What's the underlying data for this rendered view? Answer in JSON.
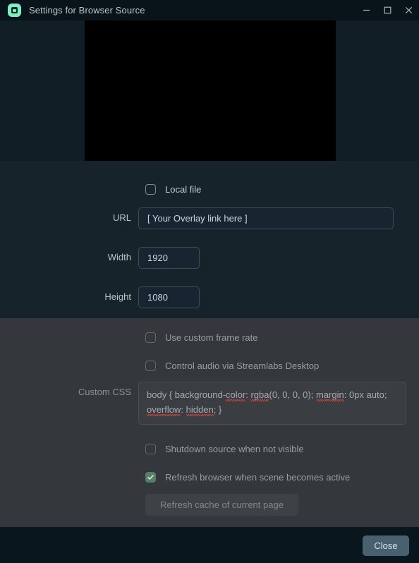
{
  "window": {
    "title": "Settings for Browser Source",
    "app_icon": "streamlabs-icon",
    "controls": {
      "minimize": "minimize-icon",
      "maximize": "maximize-icon",
      "close": "close-icon"
    }
  },
  "preview": {
    "name": "browser-source-preview",
    "background_color": "#000000"
  },
  "form": {
    "local_file": {
      "label": "Local file",
      "checked": false
    },
    "url": {
      "label": "URL",
      "value": "[ Your Overlay link here ]"
    },
    "width": {
      "label": "Width",
      "value": "1920"
    },
    "height": {
      "label": "Height",
      "value": "1080"
    },
    "use_custom_frame_rate": {
      "label": "Use custom frame rate",
      "checked": false
    },
    "control_audio": {
      "label": "Control audio via Streamlabs Desktop",
      "checked": false
    },
    "custom_css": {
      "label": "Custom CSS",
      "value": "body { background-color: rgba(0, 0, 0, 0); margin: 0px auto; overflow: hidden; }",
      "tokens": [
        {
          "text": "body { background-",
          "spellerror": false
        },
        {
          "text": "color",
          "spellerror": true
        },
        {
          "text": ": ",
          "spellerror": false
        },
        {
          "text": "rgba",
          "spellerror": true
        },
        {
          "text": "(0, 0, 0, 0); ",
          "spellerror": false
        },
        {
          "text": "margin",
          "spellerror": true
        },
        {
          "text": ": 0px auto; ",
          "spellerror": false
        },
        {
          "text": "overflow",
          "spellerror": true
        },
        {
          "text": ": ",
          "spellerror": false
        },
        {
          "text": "hidden",
          "spellerror": true
        },
        {
          "text": "; }",
          "spellerror": false
        }
      ]
    },
    "shutdown_source": {
      "label": "Shutdown source when not visible",
      "checked": false
    },
    "refresh_browser": {
      "label": "Refresh browser when scene becomes active",
      "checked": true
    },
    "refresh_cache_button": {
      "label": "Refresh cache of current page",
      "disabled": true
    }
  },
  "footer": {
    "close_button": "Close"
  },
  "colors": {
    "titlebar": "#09141a",
    "panel_upper": "#17232b",
    "panel_lower": "#34383c",
    "footer": "#09161d",
    "accent_green": "#80ecc4",
    "checkbox_checked": "#557f68",
    "close_button": "#49606e",
    "spellcheck_underline": "#d9443a"
  }
}
